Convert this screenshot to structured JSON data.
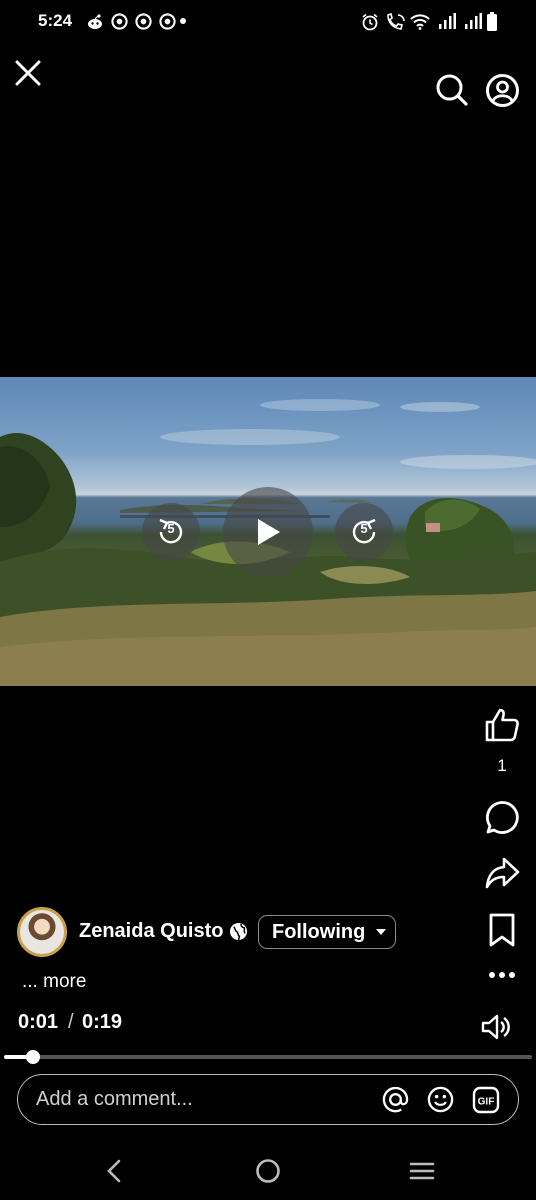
{
  "status_bar": {
    "time": "5:24",
    "left_icons": [
      "reddit-icon",
      "chrome-icon",
      "chrome-icon",
      "chrome-icon",
      "dot-icon"
    ],
    "right_icons": [
      "alarm-icon",
      "wifi-calling-icon",
      "wifi-icon",
      "signal-icon",
      "signal-icon",
      "battery-icon"
    ]
  },
  "top_bar": {
    "icons": [
      "close-icon",
      "search-icon",
      "profile-icon"
    ]
  },
  "video": {
    "controls": {
      "rewind_label": "5",
      "forward_label": "5",
      "state": "paused"
    }
  },
  "actions": {
    "like_count": "1",
    "icons": [
      "like-icon",
      "comment-icon",
      "share-icon",
      "bookmark-icon",
      "more-icon",
      "volume-icon"
    ]
  },
  "author": {
    "name": "Zenaida Quisto",
    "privacy_icon": "globe-icon",
    "follow_label": "Following"
  },
  "caption": {
    "more_label": "... more"
  },
  "playback": {
    "current_time": "0:01",
    "separator": "/",
    "total_time": "0:19",
    "progress": 0.054
  },
  "comment": {
    "placeholder": "Add a comment...",
    "icons": [
      "mention-icon",
      "emoji-icon",
      "gif-icon"
    ]
  },
  "nav_bar": {
    "icons": [
      "back-icon",
      "home-icon",
      "recents-icon"
    ]
  },
  "colors": {
    "background": "#000000",
    "text": "#ffffff",
    "avatar_ring": "#c8a24a"
  }
}
